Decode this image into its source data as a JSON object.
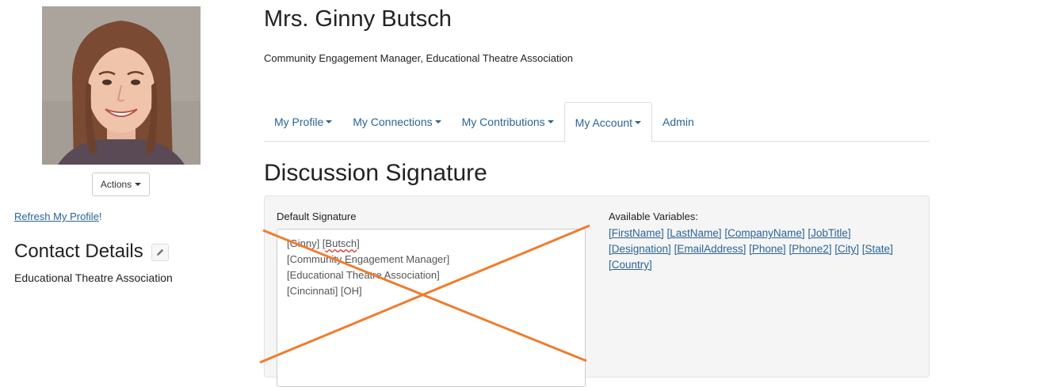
{
  "profile": {
    "name": "Mrs. Ginny Butsch",
    "title": "Community Engagement Manager, Educational Theatre Association",
    "actions_label": "Actions",
    "refresh_label": "Refresh My Profile",
    "refresh_suffix": "!"
  },
  "contact": {
    "heading": "Contact Details",
    "organization": "Educational Theatre Association"
  },
  "tabs": [
    {
      "label": "My Profile",
      "has_caret": true
    },
    {
      "label": "My Connections",
      "has_caret": true
    },
    {
      "label": "My Contributions",
      "has_caret": true
    },
    {
      "label": "My Account",
      "has_caret": true,
      "active": true
    },
    {
      "label": "Admin",
      "has_caret": false
    }
  ],
  "section": {
    "title": "Discussion Signature"
  },
  "signature": {
    "label": "Default Signature",
    "line1_a": "[Ginny] [",
    "line1_b": "Butsch",
    "line1_c": "]",
    "line2": "[Community Engagement Manager]",
    "line3": "[Educational Theatre Association]",
    "line4": "[Cincinnati] [OH]"
  },
  "variables": {
    "label": "Available Variables:",
    "items": [
      "[FirstName]",
      "[LastName]",
      "[CompanyName]",
      "[JobTitle]",
      "[Designation]",
      "[EmailAddress]",
      "[Phone]",
      "[Phone2]",
      "[City]",
      "[State]",
      "[Country]"
    ]
  },
  "colors": {
    "link": "#2a6496",
    "annotation_cross": "#f07c2e"
  }
}
